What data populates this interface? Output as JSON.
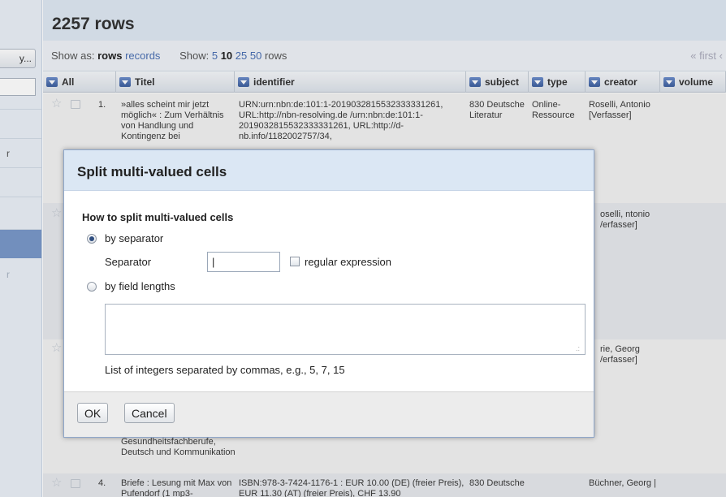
{
  "left_panel": {
    "facet_button": "y...",
    "items": [
      {
        "label": ""
      },
      {
        "label": "r"
      },
      {
        "label": ""
      },
      {
        "label": ""
      },
      {
        "label": ""
      },
      {
        "label": "r"
      }
    ]
  },
  "header": {
    "rows_count": "2257 rows"
  },
  "showbar": {
    "show_as_label": "Show as:",
    "rows_mode": "rows",
    "records_mode": "records",
    "show_label": "Show:",
    "page_sizes": [
      "5",
      "10",
      "25",
      "50"
    ],
    "selected_page_size": "10",
    "rows_suffix": "rows",
    "first_link": "« first ‹"
  },
  "columns": [
    {
      "label": "All"
    },
    {
      "label": "Titel"
    },
    {
      "label": "identifier"
    },
    {
      "label": "subject"
    },
    {
      "label": "type"
    },
    {
      "label": "creator"
    },
    {
      "label": "volume"
    }
  ],
  "rows": [
    {
      "index": "1.",
      "titel": "»alles scheint mir jetzt möglich« : Zum Verhältnis von Handlung und Kontingenz bei",
      "identifier": "URN:urn:nbn:de:101:1-2019032815532333331261, URL:http://nbn-resolving.de /urn:nbn:de:101:1-2019032815532333331261, URL:http://d-nb.info/1182002757/34,",
      "subject": "830 Deutsche Literatur",
      "type": "Online-Ressource",
      "creator": "Roselli, Antonio [Verfasser]"
    },
    {
      "index": "",
      "titel": "",
      "identifier": "",
      "subject": "",
      "type": "",
      "creator": "oselli, ntonio /erfasser]"
    },
    {
      "index": "",
      "titel": "Gesundheitsfachberufe, Deutsch und Kommunikation",
      "identifier": "",
      "subject": "",
      "type": "",
      "creator": "rie, Georg /erfasser]"
    },
    {
      "index": "4.",
      "titel": "Briefe : Lesung mit Max von Pufendorf (1 mp3-",
      "identifier": "ISBN:978-3-7424-1176-1 : EUR 10.00 (DE) (freier Preis), EUR 11.30 (AT) (freier Preis), CHF 13.90",
      "subject": "830 Deutsche",
      "type": "",
      "creator": "Büchner, Georg |"
    }
  ],
  "dialog": {
    "title": "Split multi-valued cells",
    "subtitle": "How to split multi-valued cells",
    "by_separator_label": "by separator",
    "separator_label": "Separator",
    "separator_value": "|",
    "regex_label": "regular expression",
    "by_lengths_label": "by field lengths",
    "lengths_value": "",
    "hint": "List of integers separated by commas, e.g., 5, 7, 15",
    "ok_label": "OK",
    "cancel_label": "Cancel",
    "selected_mode": "by separator",
    "regex_checked": false
  }
}
